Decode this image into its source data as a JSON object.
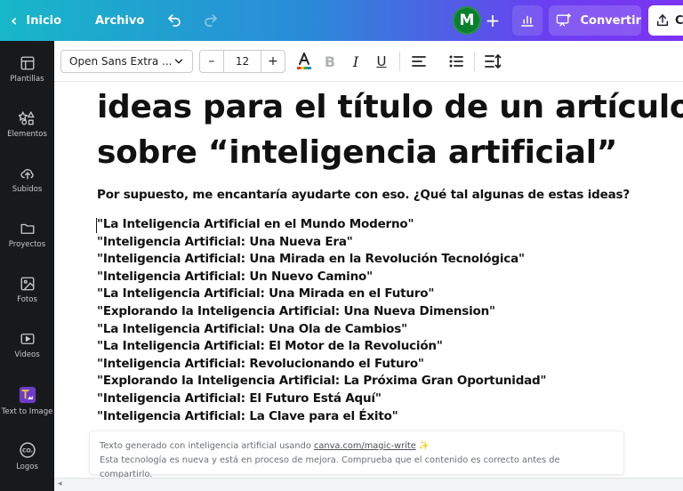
{
  "topbar": {
    "back_label": "Inicio",
    "file_label": "Archivo",
    "avatar_initial": "M",
    "convert_label": "Convertir",
    "share_label": "C"
  },
  "sidebar": {
    "items": [
      {
        "label": "Plantillas",
        "icon": "layout-icon"
      },
      {
        "label": "Elementos",
        "icon": "shapes-icon"
      },
      {
        "label": "Subidos",
        "icon": "upload-cloud-icon"
      },
      {
        "label": "Proyectos",
        "icon": "folder-icon"
      },
      {
        "label": "Fotos",
        "icon": "image-icon"
      },
      {
        "label": "Videos",
        "icon": "video-icon"
      },
      {
        "label": "Text to Image",
        "icon": "text-to-image-app-icon"
      },
      {
        "label": "Logos",
        "icon": "logo-co-icon"
      }
    ]
  },
  "toolbar": {
    "font_family_value": "Open Sans Extra ...",
    "font_size_value": "12",
    "decrease_label": "–",
    "increase_label": "+"
  },
  "document": {
    "heading_line_1": "ideas para el título de un artículo",
    "heading_line_2": "sobre “inteligencia artificial”",
    "intro": "Por supuesto, me encantaría ayudarte con eso. ¿Qué tal algunas de estas ideas?",
    "ideas": [
      "\"La Inteligencia Artificial en el Mundo Moderno\"",
      "\"Inteligencia Artificial: Una Nueva Era\"",
      "\"Inteligencia Artificial: Una Mirada en la Revolución Tecnológica\"",
      "\"Inteligencia Artificial: Un Nuevo Camino\"",
      "\"La Inteligencia Artificial: Una Mirada en el Futuro\"",
      "\"Explorando la Inteligencia Artificial: Una Nueva Dimension\"",
      "\"La Inteligencia Artificial: Una Ola de Cambios\"",
      "\"La Inteligencia Artificial: El Motor de la Revolución\"",
      "\"Inteligencia Artificial: Revolucionando el Futuro\"",
      "\"Explorando la Inteligencia Artificial: La Próxima Gran Oportunidad\"",
      "\"Inteligencia Artificial: El Futuro Está Aquí\"",
      "\"Inteligencia Artificial: La Clave para el Éxito\""
    ]
  },
  "notice": {
    "line1_prefix": "Texto generado con inteligencia artificial usando ",
    "link": "canva.com/magic-write",
    "sparkle": "✨",
    "line2": "Esta tecnología es nueva y está en proceso de mejora. Comprueba que el contenido es correcto antes de compartirlo."
  },
  "colors": {
    "gradient_start": "#17b7c8",
    "gradient_end": "#7b33f2",
    "sidebar_bg": "#18191b",
    "avatar_bg": "#0a7f2e"
  }
}
